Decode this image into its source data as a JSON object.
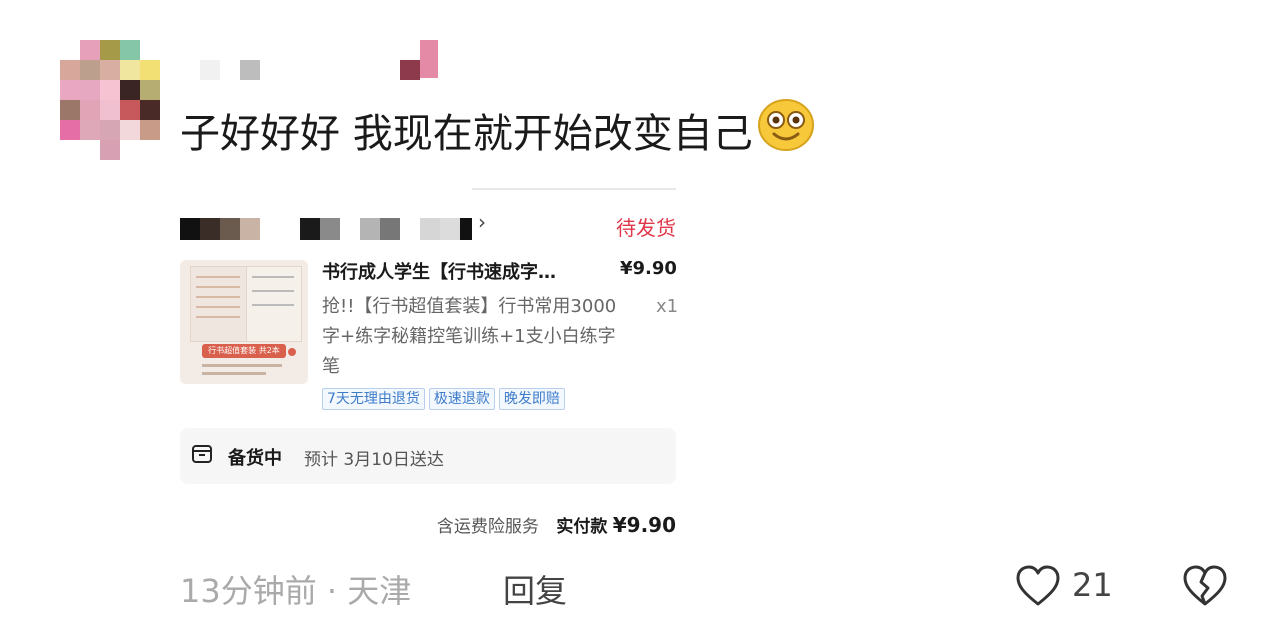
{
  "comment": {
    "text": "子好好好 我现在就开始改变自己",
    "emoji": "grinning-face-emoji"
  },
  "order_card": {
    "shop_chevron": "›",
    "status": "待发货",
    "product_title": "书行成人学生【行书速成字…",
    "price": "¥9.90",
    "description": "抢!!【行书超值套装】行书常用3000字+练字秘籍控笔训练+1支小白练字笔",
    "quantity": "x1",
    "thumbnail_banner": "行书超值套装 共2本",
    "service_tags": [
      "7天无理由退货",
      "极速退款",
      "晚发即赔"
    ],
    "shipping_status": "备货中",
    "shipping_eta": "预计 3月10日送达",
    "insurance_note": "含运费险服务",
    "paid_label": "实付款",
    "paid_amount": "¥9.90"
  },
  "footer": {
    "time_location": "13分钟前 · 天津",
    "reply_label": "回复",
    "like_count": "21"
  },
  "colors": {
    "status_red": "#e0384a",
    "tag_blue": "#3d7cc9"
  }
}
